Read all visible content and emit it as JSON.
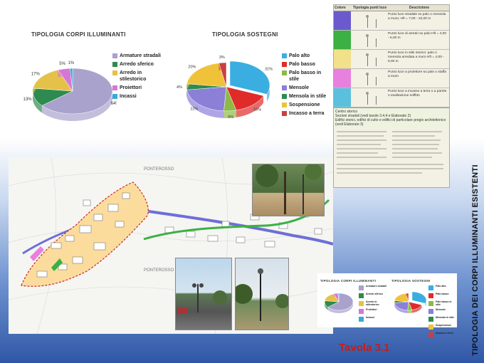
{
  "side_title": "TIPOLOGIA DEI CORPI ILLUMINANTI ESISTENTI",
  "footer": "Tavola 3.1",
  "chart_data": [
    {
      "type": "pie",
      "title": "TIPOLOGIA CORPI ILLUMINANTI",
      "categories": [
        "Armature stradali",
        "Arredo sferico",
        "Arredo in stilestorico",
        "Proiettori",
        "Incassi"
      ],
      "values": [
        64,
        13,
        17,
        5,
        1
      ],
      "slice_labels": [
        "64%",
        "13%",
        "17%",
        "5%",
        "1%"
      ],
      "colors": [
        "#a9a2cc",
        "#2e8b4f",
        "#e4c24a",
        "#d777d4",
        "#38a9d9"
      ]
    },
    {
      "type": "pie",
      "title": "TIPOLOGIA SOSTEGNI",
      "categories": [
        "Palo alto",
        "Palo basso",
        "Palo basso in stile",
        "Mensole",
        "Mensola in stile",
        "Sospensione",
        "Incasso a terra"
      ],
      "values": [
        31,
        15,
        5,
        22,
        4,
        20,
        3
      ],
      "slice_labels": [
        "31%",
        "15%",
        "5%",
        "22%",
        "4%",
        "20%",
        "3%"
      ],
      "colors": [
        "#3aaee0",
        "#e02b2b",
        "#8cba45",
        "#8b7fd8",
        "#2e8b4f",
        "#f0c23a",
        "#c94040"
      ]
    }
  ],
  "legend_table": {
    "headers": [
      "Colore",
      "Tipologia punti luce",
      "Descrizione"
    ],
    "rows": [
      {
        "color": "#6a5acd",
        "desc": "Punto luce stradale su palo o mensola a muro; Hft = 7,00 - 10,00 m"
      },
      {
        "color": "#3cb043",
        "desc": "Punto luce di arredo su palo Hft = 4,00 - 6,00 m"
      },
      {
        "color": "#f2e08a",
        "desc": "Punto luce in stile storico: palo o mensola arredata a muro Hft = 4,00 - 6,00 m"
      },
      {
        "color": "#e880e0",
        "desc": "Punto luce a proiettore su palo o staffa a muro"
      },
      {
        "color": "#5bc0de",
        "desc": "Punto luce a incasso a terra o a parete o esalitazione soffitto"
      }
    ],
    "extra_lines": [
      "Centro storico",
      "Sezioni stradali (vedi tavole 3.4,4 e Elaborato 2)",
      "Edifici storici, edifici di culto e edifici di particolare pregio architettonico (vedi Elaborato 3)"
    ]
  },
  "map_labels": [
    "PONTEROSSO",
    "PONTEROSSO"
  ]
}
